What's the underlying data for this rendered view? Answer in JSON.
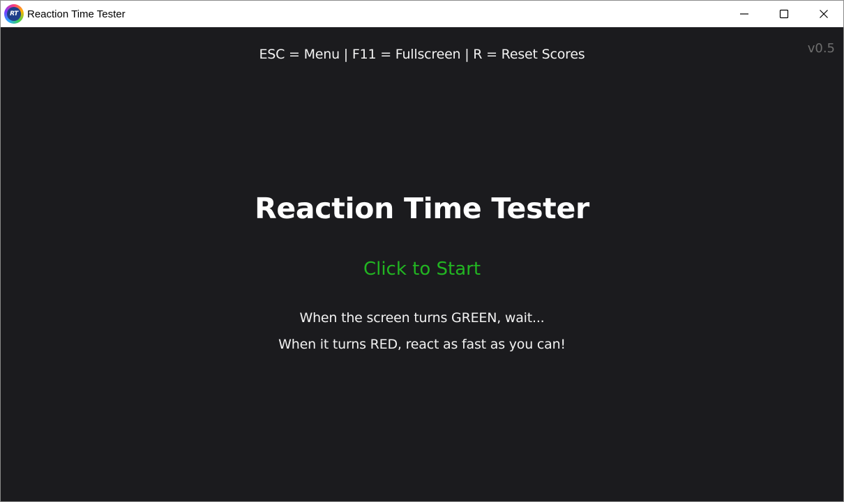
{
  "window": {
    "title": "Reaction Time Tester",
    "icon_name": "reaction-time-app-icon",
    "icon_text": "RT",
    "controls": [
      "minimize-icon",
      "maximize-icon",
      "close-icon"
    ]
  },
  "colors": {
    "background": "#1b1b1e",
    "start_text": "#22b522",
    "text": "#f2f2f2",
    "version_text": "#6e6e6e"
  },
  "screen": {
    "hint": "ESC = Menu | F11 = Fullscreen | R = Reset Scores",
    "version": "v0.5",
    "title": "Reaction Time Tester",
    "start_label": "Click to Start",
    "instructions": [
      "When the screen turns GREEN, wait...",
      "When it turns RED, react as fast as you can!"
    ]
  }
}
